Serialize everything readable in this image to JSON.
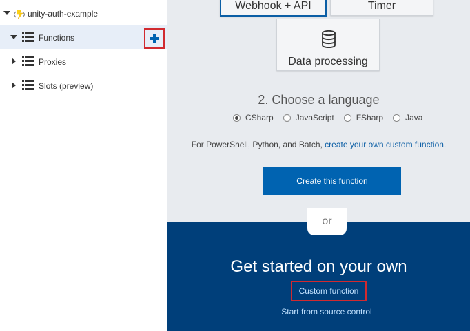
{
  "sidebar": {
    "root_label": "unity-auth-example",
    "items": [
      {
        "label": "Functions",
        "expanded": true
      },
      {
        "label": "Proxies",
        "expanded": false
      },
      {
        "label": "Slots (preview)",
        "expanded": false
      }
    ]
  },
  "templates": {
    "webhook_label": "Webhook + API",
    "timer_label": "Timer",
    "data_processing_label": "Data processing"
  },
  "language": {
    "title": "2. Choose a language",
    "options": [
      "CSharp",
      "JavaScript",
      "FSharp",
      "Java"
    ],
    "selected": "CSharp"
  },
  "custom_note": {
    "text": "For PowerShell, Python, and Batch, ",
    "link": "create your own custom function."
  },
  "create_button_label": "Create this function",
  "or_label": "or",
  "own": {
    "title": "Get started on your own",
    "custom_function_link": "Custom function",
    "source_control_link": "Start from source control"
  },
  "colors": {
    "accent": "#0063b1",
    "dark_panel": "#003f7a",
    "highlight": "#d12a2f"
  }
}
